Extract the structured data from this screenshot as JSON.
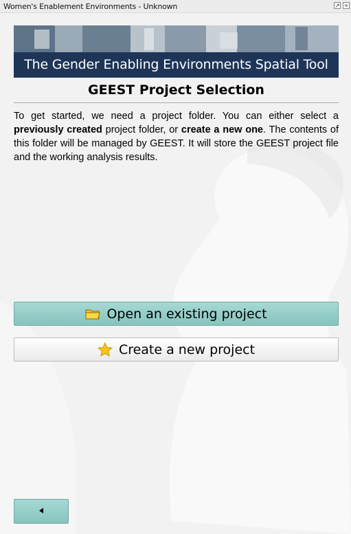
{
  "window": {
    "title": "Women's Enablement Environments - Unknown"
  },
  "banner": {
    "caption": "The Gender Enabling Environments Spatial Tool"
  },
  "page": {
    "title": "GEEST Project Selection",
    "intro": {
      "part1": "To get started, we need a project folder. You can either select a ",
      "bold1": "previously created",
      "part2": " project folder, or ",
      "bold2": "create a new one",
      "part3": ". The contents of this folder will be managed by GEEST. It will store the GEEST project file and the working analysis results."
    }
  },
  "actions": {
    "open_label": "Open an existing project",
    "open_icon": "folder-icon",
    "new_label": "Create a new project",
    "new_icon": "star-icon",
    "back_icon": "back-arrow-icon"
  },
  "colors": {
    "banner_caption_bg": "#1e3558",
    "primary_button": "#9fd3cd",
    "folder": "#f5c518",
    "star": "#f5c518"
  }
}
